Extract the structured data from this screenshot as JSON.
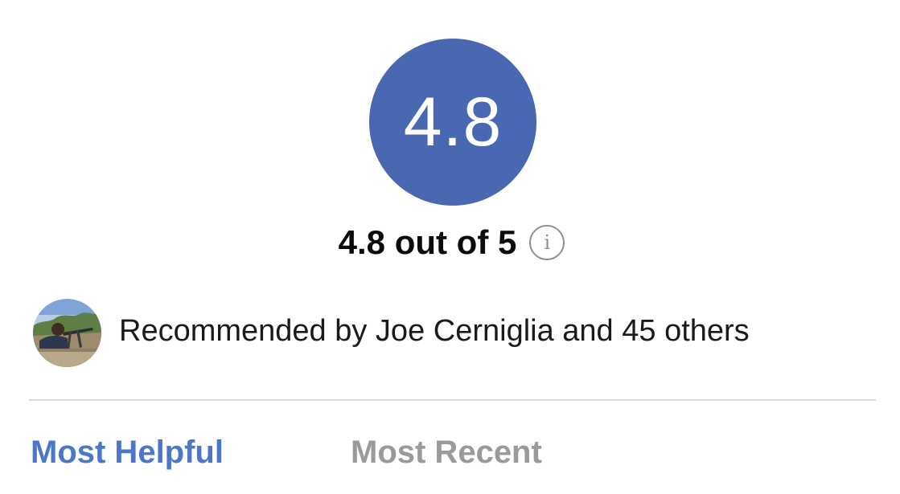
{
  "rating": {
    "value": "4.8",
    "summary": "4.8 out of 5",
    "info_icon": "info-icon",
    "circle_color": "#4a67b2"
  },
  "recommendation": {
    "avatar_icon": "user-avatar",
    "text": "Recommended by Joe Cerniglia and 45 others"
  },
  "tabs": [
    {
      "label": "Most Helpful",
      "active": true
    },
    {
      "label": "Most Recent",
      "active": false
    }
  ],
  "colors": {
    "active_tab": "#4a77c8",
    "inactive_tab": "#9a9a9a",
    "divider": "#dddddd"
  }
}
